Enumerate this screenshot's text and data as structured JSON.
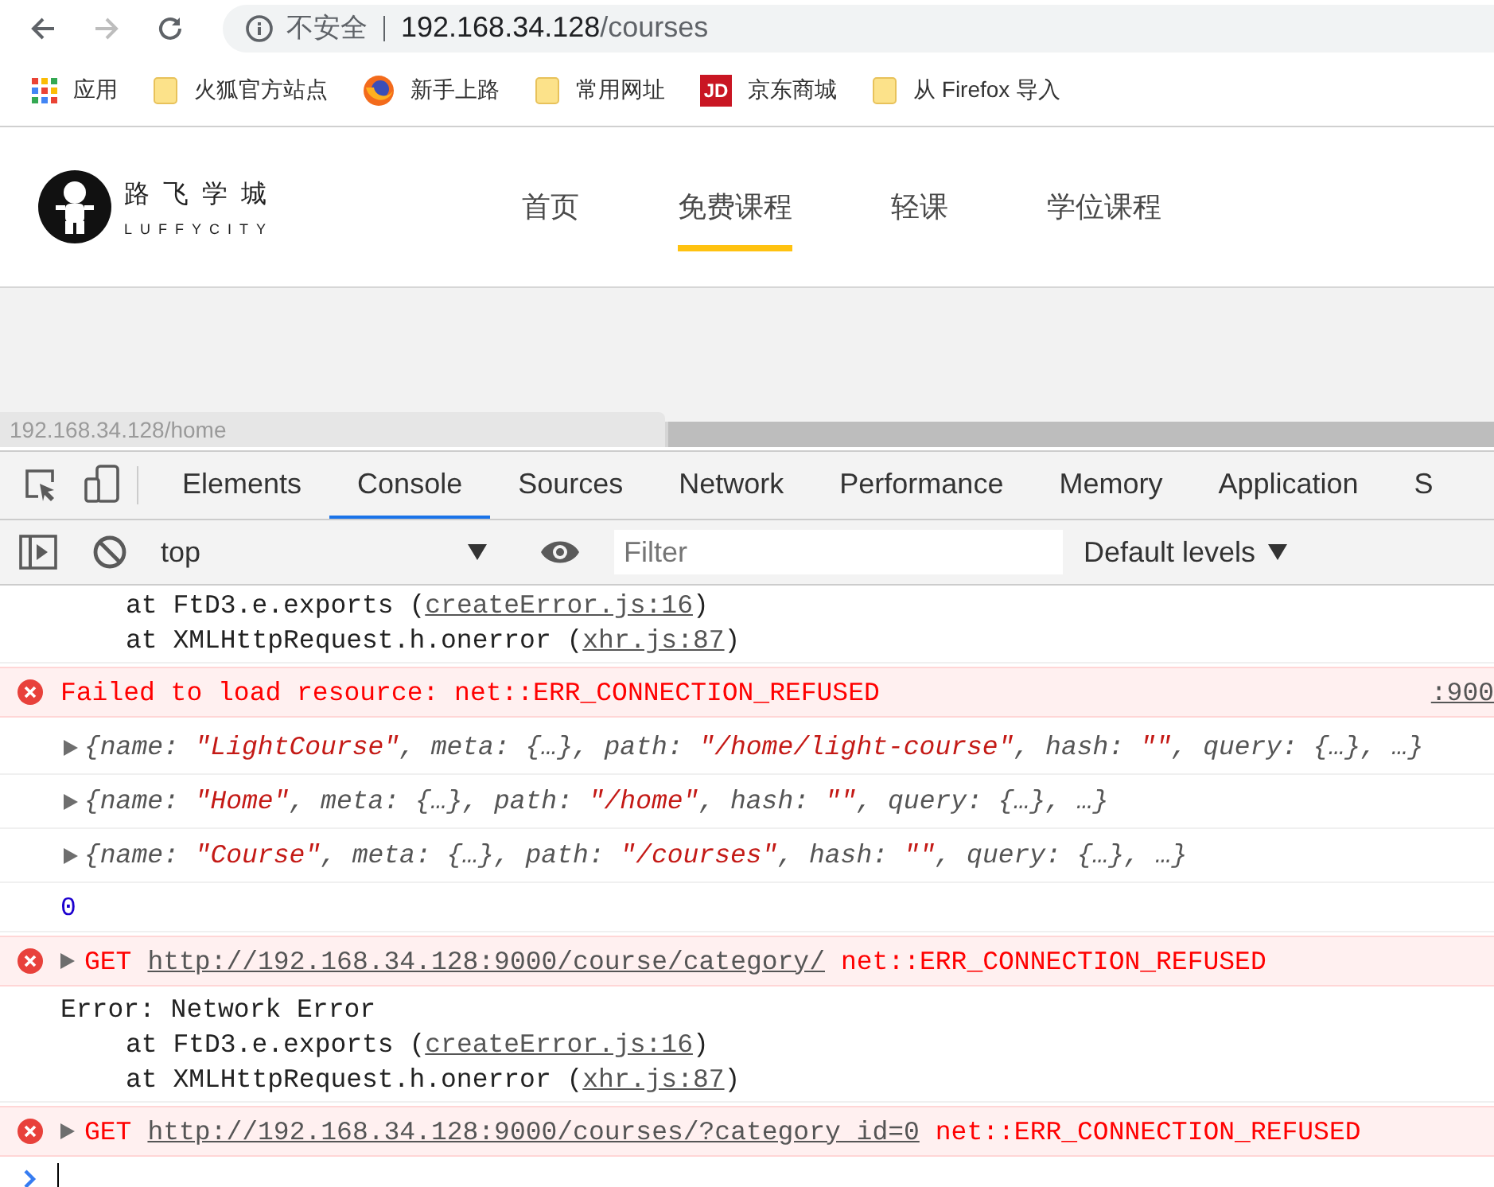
{
  "browser": {
    "back": {
      "disabled": false
    },
    "forward": {
      "disabled": true
    },
    "address": {
      "security": "不安全",
      "host": "192.168.34.128",
      "path": "/courses"
    },
    "bookmarks": [
      {
        "kind": "apps",
        "label": "应用"
      },
      {
        "kind": "folder",
        "label": "火狐官方站点"
      },
      {
        "kind": "firefox",
        "label": "新手上路"
      },
      {
        "kind": "folder",
        "label": "常用网址"
      },
      {
        "kind": "jd",
        "label": "京东商城",
        "icon_text": "JD"
      },
      {
        "kind": "folder",
        "label": "从 Firefox 导入"
      }
    ]
  },
  "site": {
    "logo": {
      "title": "路 飞 学 城",
      "subtitle": "LUFFYCITY"
    },
    "nav": [
      {
        "label": "首页",
        "selected": false
      },
      {
        "label": "免费课程",
        "selected": true
      },
      {
        "label": "轻课",
        "selected": false
      },
      {
        "label": "学位课程",
        "selected": false
      }
    ],
    "status_bubble": "192.168.34.128/home"
  },
  "devtools": {
    "tabs": [
      {
        "label": "Elements",
        "selected": false
      },
      {
        "label": "Console",
        "selected": true
      },
      {
        "label": "Sources",
        "selected": false
      },
      {
        "label": "Network",
        "selected": false
      },
      {
        "label": "Performance",
        "selected": false
      },
      {
        "label": "Memory",
        "selected": false
      },
      {
        "label": "Application",
        "selected": false
      },
      {
        "label": "S",
        "selected": false
      }
    ],
    "console_toolbar": {
      "context": "top",
      "filter_placeholder": "Filter",
      "levels": "Default levels"
    },
    "messages": [
      {
        "kind": "stack",
        "lines": [
          {
            "kind": "frame",
            "prefix": "at FtD3.e.exports (",
            "link": "createError.js:16",
            "suffix": ")"
          },
          {
            "kind": "frame",
            "prefix": "at XMLHttpRequest.h.onerror (",
            "link": "xhr.js:87",
            "suffix": ")"
          }
        ]
      },
      {
        "kind": "error",
        "text": "Failed to load resource: net::ERR_CONNECTION_REFUSED",
        "source": ":900"
      },
      {
        "kind": "object",
        "expanded": false,
        "tokens": [
          {
            "kind": "key",
            "text": "{name: "
          },
          {
            "kind": "string",
            "text": "\"LightCourse\""
          },
          {
            "kind": "key",
            "text": ", meta: {…}, path: "
          },
          {
            "kind": "string",
            "text": "\"/home/light-course\""
          },
          {
            "kind": "key",
            "text": ", hash: "
          },
          {
            "kind": "string",
            "text": "\"\""
          },
          {
            "kind": "key",
            "text": ", query: {…}, …}"
          }
        ]
      },
      {
        "kind": "object",
        "expanded": false,
        "tokens": [
          {
            "kind": "key",
            "text": "{name: "
          },
          {
            "kind": "string",
            "text": "\"Home\""
          },
          {
            "kind": "key",
            "text": ", meta: {…}, path: "
          },
          {
            "kind": "string",
            "text": "\"/home\""
          },
          {
            "kind": "key",
            "text": ", hash: "
          },
          {
            "kind": "string",
            "text": "\"\""
          },
          {
            "kind": "key",
            "text": ", query: {…}, …}"
          }
        ]
      },
      {
        "kind": "object",
        "expanded": false,
        "tokens": [
          {
            "kind": "key",
            "text": "{name: "
          },
          {
            "kind": "string",
            "text": "\"Course\""
          },
          {
            "kind": "key",
            "text": ", meta: {…}, path: "
          },
          {
            "kind": "string",
            "text": "\"/courses\""
          },
          {
            "kind": "key",
            "text": ", hash: "
          },
          {
            "kind": "string",
            "text": "\"\""
          },
          {
            "kind": "key",
            "text": ", query: {…}, …}"
          }
        ]
      },
      {
        "kind": "number",
        "text": "0"
      },
      {
        "kind": "network_error",
        "expanded": false,
        "method": "GET",
        "url": "http://192.168.34.128:9000/course/category/",
        "status": "net::ERR_CONNECTION_REFUSED"
      },
      {
        "kind": "stack",
        "lines": [
          {
            "kind": "text",
            "text": "Error: Network Error"
          },
          {
            "kind": "frame",
            "prefix": "at FtD3.e.exports (",
            "link": "createError.js:16",
            "suffix": ")"
          },
          {
            "kind": "frame",
            "prefix": "at XMLHttpRequest.h.onerror (",
            "link": "xhr.js:87",
            "suffix": ")"
          }
        ]
      },
      {
        "kind": "network_error",
        "expanded": false,
        "method": "GET",
        "url": "http://192.168.34.128:9000/courses/?category_id=0",
        "status": "net::ERR_CONNECTION_REFUSED"
      }
    ]
  }
}
